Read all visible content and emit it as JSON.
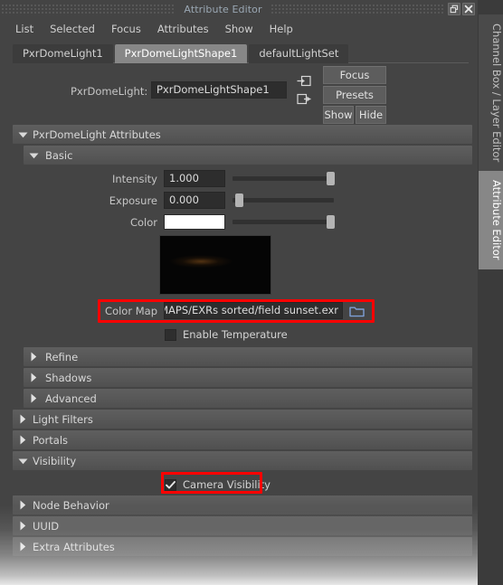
{
  "window": {
    "title": "Attribute Editor",
    "restore_icon": "restore-icon",
    "close_icon": "close-icon"
  },
  "menubar": {
    "items": [
      {
        "label": "List"
      },
      {
        "label": "Selected"
      },
      {
        "label": "Focus"
      },
      {
        "label": "Attributes"
      },
      {
        "label": "Show"
      },
      {
        "label": "Help"
      }
    ]
  },
  "node_tabs": [
    {
      "label": "PxrDomeLight1",
      "active": false
    },
    {
      "label": "PxrDomeLightShape1",
      "active": true
    },
    {
      "label": "defaultLightSet",
      "active": false
    }
  ],
  "node_header": {
    "type_label": "PxrDomeLight:",
    "name_value": "PxrDomeLightShape1",
    "input_arrow_icon": "input-connection-icon",
    "output_arrow_icon": "output-connection-icon",
    "focus_button": "Focus",
    "presets_button": "Presets",
    "show_button": "Show",
    "hide_button": "Hide"
  },
  "sections": {
    "attributes_header": "PxrDomeLight Attributes",
    "basic_header": "Basic",
    "refine": "Refine",
    "shadows": "Shadows",
    "advanced": "Advanced",
    "light_filters": "Light Filters",
    "portals": "Portals",
    "visibility": "Visibility",
    "node_behavior": "Node Behavior",
    "uuid": "UUID",
    "extra_attributes": "Extra Attributes"
  },
  "basic": {
    "intensity": {
      "label": "Intensity",
      "value": "1.000",
      "slider_percent": 93
    },
    "exposure": {
      "label": "Exposure",
      "value": "0.000",
      "slider_percent": 3
    },
    "color": {
      "label": "Color",
      "swatch_hex": "#ffffff",
      "slider_percent": 93
    },
    "color_map": {
      "label": "Color Map",
      "value": "HDRI MAPS/EXRs sorted/field sunset.exr",
      "browse_icon": "folder-browse-icon"
    },
    "enable_temperature": {
      "label": "Enable Temperature",
      "checked": false
    }
  },
  "visibility": {
    "camera_visibility": {
      "label": "Camera Visibility",
      "checked": true
    }
  },
  "side_tabs": [
    {
      "label": "Channel Box / Layer Editor",
      "active": false
    },
    {
      "label": "Attribute Editor",
      "active": true
    }
  ],
  "colors": {
    "highlight": "#ff0000",
    "panel_bg": "#444444",
    "active_tab": "#878787",
    "field_bg": "#2d2d2d",
    "title_text": "#9aa7b3"
  }
}
